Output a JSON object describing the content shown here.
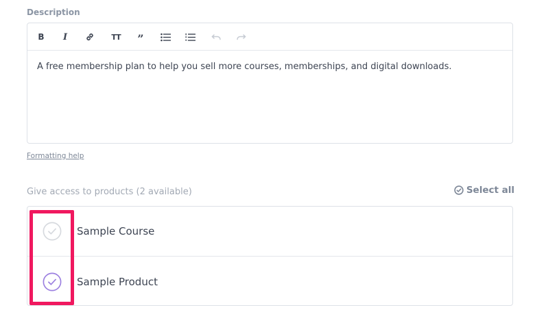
{
  "description": {
    "label": "Description",
    "toolbar": {
      "items": [
        "bold",
        "italic",
        "link",
        "heading",
        "quote",
        "bulleted-list",
        "numbered-list",
        "undo",
        "redo"
      ]
    },
    "content": "A free membership plan to help you sell more courses, memberships, and digital downloads.",
    "formatting_help": "Formatting help"
  },
  "access": {
    "label": "Give access to products (2 available)",
    "select_all": "Select all",
    "products": [
      {
        "name": "Sample Course",
        "selected": false
      },
      {
        "name": "Sample Product",
        "selected": true
      }
    ]
  },
  "colors": {
    "accent": "#9b7fe0",
    "highlight": "#f0185f",
    "unselected": "#d6d9de"
  }
}
